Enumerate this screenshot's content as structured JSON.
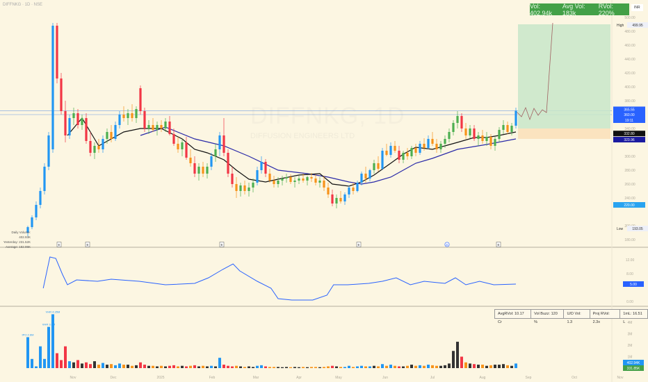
{
  "header": {
    "title": "DIFFNKG · 1D · NSE",
    "currency": "INR"
  },
  "watermark": {
    "symbol": "DIFFNKG, 1D",
    "company": "DIFFUSION ENGINEERS LTD"
  },
  "volume_box": {
    "vol": "Vol: 402.94k",
    "avg": "Avg Vol: 183k",
    "rvol": "RVol: 220%"
  },
  "daily_volume": {
    "daily": "Daily Volume: 402.93K",
    "yesterday": "Yesterday: 231.52K",
    "average": "Average: 182.99K"
  },
  "info_box": [
    "AvgRVol: 10.17 Cr",
    "Vol Buzz: 120 %",
    "U/D Vol: 1.3",
    "Proj RVol: 2.3x",
    "1mL: 16.51 L"
  ],
  "colors": {
    "up": "#4caf50",
    "down": "#f7931a",
    "strong_down": "#f23645",
    "strong_up": "#2196f3",
    "ma_short": "#111111",
    "ma_long": "#2a2aa8",
    "indicator": "#2962ff",
    "target_zone": "#c8e6c9",
    "stop_zone": "#fbe3bf"
  },
  "chart_data": [
    {
      "type": "candlestick",
      "price_axis": {
        "ticks": [
          "500.00",
          "480.00",
          "460.00",
          "440.00",
          "420.00",
          "400.00",
          "380.00",
          "340.00",
          "300.00",
          "280.00",
          "260.00",
          "240.00",
          "200.00",
          "180.00"
        ],
        "range": [
          175,
          505
        ]
      },
      "price_labels": {
        "high_label": "High",
        "high": "499.95",
        "low_label": "Low",
        "low": "193.05",
        "last": "365.55",
        "level": "360.00",
        "countdown": "19:11",
        "ma_short": "332.80",
        "ma_long": "323.96",
        "support": "220.00"
      },
      "time_axis": [
        "Nov",
        "Dec",
        "2025",
        "Feb",
        "Mar",
        "Apr",
        "May",
        "Jun",
        "Jul",
        "Aug",
        "Sep",
        "Oct",
        "Nov"
      ],
      "events": [
        "E",
        "E",
        "E",
        "E",
        "D",
        "E"
      ],
      "candles_ohlc": [
        [
          190,
          200,
          185,
          198
        ],
        [
          198,
          215,
          195,
          212
        ],
        [
          212,
          235,
          208,
          230
        ],
        [
          230,
          255,
          225,
          250
        ],
        [
          250,
          290,
          245,
          285
        ],
        [
          285,
          335,
          280,
          330
        ],
        [
          310,
          492,
          305,
          488
        ],
        [
          488,
          492,
          405,
          412
        ],
        [
          412,
          420,
          360,
          365
        ],
        [
          365,
          380,
          320,
          330
        ],
        [
          330,
          360,
          325,
          355
        ],
        [
          355,
          370,
          345,
          362
        ],
        [
          362,
          368,
          340,
          345
        ],
        [
          345,
          360,
          338,
          355
        ],
        [
          355,
          362,
          318,
          322
        ],
        [
          322,
          335,
          300,
          305
        ],
        [
          305,
          320,
          296,
          315
        ],
        [
          315,
          325,
          305,
          310
        ],
        [
          310,
          330,
          305,
          325
        ],
        [
          325,
          340,
          318,
          335
        ],
        [
          335,
          345,
          320,
          325
        ],
        [
          325,
          350,
          322,
          345
        ],
        [
          345,
          365,
          340,
          360
        ],
        [
          360,
          372,
          350,
          355
        ],
        [
          355,
          368,
          345,
          362
        ],
        [
          362,
          375,
          350,
          355
        ],
        [
          355,
          372,
          348,
          368
        ],
        [
          398,
          402,
          360,
          365
        ],
        [
          365,
          370,
          335,
          340
        ],
        [
          340,
          352,
          332,
          345
        ],
        [
          345,
          355,
          335,
          338
        ],
        [
          338,
          350,
          330,
          345
        ],
        [
          345,
          352,
          335,
          340
        ],
        [
          340,
          355,
          335,
          350
        ],
        [
          350,
          358,
          330,
          332
        ],
        [
          332,
          340,
          315,
          318
        ],
        [
          318,
          328,
          305,
          310
        ],
        [
          310,
          325,
          300,
          320
        ],
        [
          320,
          328,
          295,
          298
        ],
        [
          298,
          310,
          285,
          290
        ],
        [
          290,
          300,
          270,
          275
        ],
        [
          275,
          290,
          265,
          285
        ],
        [
          285,
          292,
          270,
          275
        ],
        [
          275,
          290,
          268,
          285
        ],
        [
          285,
          305,
          280,
          300
        ],
        [
          300,
          318,
          292,
          310
        ],
        [
          310,
          335,
          300,
          330
        ],
        [
          330,
          355,
          300,
          305
        ],
        [
          305,
          310,
          270,
          275
        ],
        [
          275,
          285,
          255,
          260
        ],
        [
          260,
          270,
          240,
          250
        ],
        [
          250,
          262,
          242,
          258
        ],
        [
          258,
          265,
          245,
          250
        ],
        [
          250,
          262,
          242,
          255
        ],
        [
          255,
          268,
          248,
          262
        ],
        [
          262,
          285,
          258,
          280
        ],
        [
          280,
          300,
          275,
          292
        ],
        [
          292,
          296,
          270,
          275
        ],
        [
          275,
          282,
          262,
          265
        ],
        [
          265,
          272,
          255,
          260
        ],
        [
          260,
          270,
          255,
          265
        ],
        [
          265,
          272,
          258,
          268
        ],
        [
          268,
          275,
          262,
          270
        ],
        [
          270,
          274,
          260,
          263
        ],
        [
          263,
          270,
          255,
          265
        ],
        [
          265,
          272,
          260,
          268
        ],
        [
          268,
          275,
          262,
          265
        ],
        [
          265,
          272,
          258,
          270
        ],
        [
          270,
          276,
          263,
          268
        ],
        [
          268,
          274,
          258,
          262
        ],
        [
          262,
          270,
          255,
          265
        ],
        [
          265,
          272,
          250,
          255
        ],
        [
          255,
          262,
          240,
          245
        ],
        [
          245,
          252,
          228,
          232
        ],
        [
          232,
          245,
          225,
          240
        ],
        [
          240,
          250,
          232,
          235
        ],
        [
          235,
          248,
          230,
          245
        ],
        [
          245,
          258,
          240,
          255
        ],
        [
          255,
          262,
          245,
          250
        ],
        [
          250,
          265,
          248,
          262
        ],
        [
          262,
          278,
          258,
          275
        ],
        [
          275,
          285,
          262,
          268
        ],
        [
          268,
          282,
          264,
          280
        ],
        [
          280,
          295,
          275,
          290
        ],
        [
          290,
          300,
          278,
          282
        ],
        [
          282,
          312,
          280,
          308
        ],
        [
          308,
          318,
          300,
          302
        ],
        [
          302,
          320,
          298,
          315
        ],
        [
          315,
          322,
          305,
          308
        ],
        [
          308,
          315,
          290,
          295
        ],
        [
          295,
          308,
          290,
          305
        ],
        [
          305,
          312,
          295,
          300
        ],
        [
          300,
          315,
          296,
          312
        ],
        [
          312,
          318,
          300,
          305
        ],
        [
          305,
          322,
          302,
          318
        ],
        [
          318,
          326,
          308,
          312
        ],
        [
          312,
          330,
          310,
          325
        ],
        [
          325,
          335,
          315,
          318
        ],
        [
          318,
          325,
          305,
          310
        ],
        [
          310,
          322,
          305,
          318
        ],
        [
          318,
          330,
          312,
          325
        ],
        [
          325,
          340,
          320,
          335
        ],
        [
          335,
          352,
          330,
          348
        ],
        [
          348,
          365,
          340,
          358
        ],
        [
          358,
          362,
          335,
          340
        ],
        [
          340,
          348,
          325,
          330
        ],
        [
          330,
          345,
          326,
          340
        ],
        [
          340,
          345,
          322,
          325
        ],
        [
          325,
          335,
          315,
          330
        ],
        [
          330,
          338,
          318,
          322
        ],
        [
          322,
          335,
          315,
          328
        ],
        [
          328,
          332,
          310,
          315
        ],
        [
          315,
          328,
          308,
          325
        ],
        [
          325,
          342,
          320,
          338
        ],
        [
          338,
          352,
          332,
          345
        ],
        [
          345,
          350,
          332,
          335
        ],
        [
          335,
          348,
          330,
          344
        ],
        [
          344,
          370,
          340,
          365.55
        ]
      ],
      "ma_short": [
        [
          9.5,
          330
        ],
        [
          13,
          355
        ],
        [
          17,
          315
        ],
        [
          20,
          325
        ],
        [
          23,
          335
        ],
        [
          27,
          340
        ],
        [
          32,
          340
        ],
        [
          37,
          325
        ],
        [
          40,
          310
        ],
        [
          43,
          305
        ],
        [
          47,
          295
        ],
        [
          50,
          280
        ],
        [
          53,
          267
        ],
        [
          57,
          263
        ],
        [
          60,
          267
        ],
        [
          65,
          273
        ],
        [
          70,
          275
        ],
        [
          73,
          260
        ],
        [
          77,
          257
        ],
        [
          80,
          263
        ],
        [
          83,
          273
        ],
        [
          87,
          290
        ],
        [
          90,
          303
        ],
        [
          93,
          313
        ],
        [
          97,
          310
        ],
        [
          100,
          315
        ],
        [
          103,
          320
        ],
        [
          107,
          327
        ],
        [
          110,
          327
        ],
        [
          113,
          330
        ],
        [
          117,
          335
        ]
      ],
      "ma_long": [
        [
          27,
          330
        ],
        [
          33,
          342
        ],
        [
          40,
          325
        ],
        [
          47,
          315
        ],
        [
          53,
          300
        ],
        [
          60,
          280
        ],
        [
          67,
          275
        ],
        [
          72,
          270
        ],
        [
          77,
          263
        ],
        [
          80,
          260
        ],
        [
          83,
          263
        ],
        [
          87,
          270
        ],
        [
          90,
          280
        ],
        [
          93,
          290
        ],
        [
          97,
          297
        ],
        [
          103,
          310
        ],
        [
          110,
          317
        ],
        [
          117,
          325
        ]
      ],
      "projection": {
        "target": 490,
        "entry": 340,
        "stop": 325
      }
    },
    {
      "type": "line",
      "axis_ticks": [
        "12.00",
        "8.00",
        "0.00"
      ],
      "last_value": "5.00",
      "range": [
        0,
        14
      ],
      "points": [
        [
          3.7,
          3.8
        ],
        [
          5.3,
          12.8
        ],
        [
          6.7,
          12.4
        ],
        [
          8.3,
          7.8
        ],
        [
          9.5,
          4.8
        ],
        [
          11.7,
          6.2
        ],
        [
          16.7,
          5.8
        ],
        [
          20,
          6.4
        ],
        [
          26.7,
          5.8
        ],
        [
          33,
          4.8
        ],
        [
          40,
          5.2
        ],
        [
          43.3,
          6.8
        ],
        [
          46.7,
          9.2
        ],
        [
          49.2,
          10.8
        ],
        [
          50.8,
          8.8
        ],
        [
          55,
          5.8
        ],
        [
          58.3,
          3.8
        ],
        [
          60,
          0.8
        ],
        [
          63.3,
          0.4
        ],
        [
          68.3,
          0.4
        ],
        [
          71.7,
          1.8
        ],
        [
          73.3,
          4.8
        ],
        [
          76.7,
          4.8
        ],
        [
          81.7,
          5.2
        ],
        [
          85,
          5.8
        ],
        [
          88.3,
          6.8
        ],
        [
          91.7,
          4.8
        ],
        [
          95,
          5.8
        ],
        [
          100,
          5.2
        ],
        [
          102.5,
          6.8
        ],
        [
          105,
          4.8
        ],
        [
          108.3,
          5.8
        ],
        [
          111.7,
          4.8
        ],
        [
          117,
          5.0
        ]
      ]
    },
    {
      "type": "bar",
      "axis_ticks": [
        "5M",
        "4M",
        "3M",
        "2M",
        "1M"
      ],
      "last_value": "402.94K",
      "average_value": "331.85K",
      "unit": "M",
      "annotations": [
        {
          "index": 0,
          "text": "IPO 2.6M"
        },
        {
          "index": 5,
          "text": "VHR 3.6M"
        },
        {
          "index": 6,
          "text": "VHR 4.35M"
        }
      ],
      "values": [
        2.7,
        0.8,
        0.15,
        1.9,
        0.8,
        3.6,
        4.7,
        1.3,
        0.7,
        1.9,
        0.6,
        0.5,
        0.7,
        0.4,
        0.5,
        0.35,
        0.6,
        0.3,
        0.45,
        0.3,
        0.35,
        0.25,
        0.4,
        0.3,
        0.3,
        0.2,
        0.25,
        0.5,
        0.3,
        0.2,
        0.2,
        0.15,
        0.2,
        0.15,
        0.2,
        0.25,
        0.15,
        0.2,
        0.15,
        0.2,
        0.25,
        0.15,
        0.2,
        0.15,
        0.2,
        0.15,
        0.9,
        0.3,
        0.2,
        0.15,
        0.2,
        0.15,
        0.1,
        0.15,
        0.1,
        0.2,
        0.25,
        0.15,
        0.1,
        0.1,
        0.1,
        0.08,
        0.1,
        0.08,
        0.1,
        0.08,
        0.1,
        0.08,
        0.1,
        0.1,
        0.08,
        0.1,
        0.15,
        0.2,
        0.15,
        0.1,
        0.1,
        0.2,
        0.1,
        0.15,
        0.2,
        0.15,
        0.15,
        0.2,
        0.15,
        0.35,
        0.2,
        0.3,
        0.2,
        0.15,
        0.15,
        0.2,
        0.3,
        0.2,
        0.25,
        0.2,
        0.3,
        0.25,
        0.2,
        0.2,
        0.25,
        0.4,
        1.5,
        2.3,
        1.0,
        0.5,
        0.4,
        0.35,
        0.3,
        0.3,
        0.2,
        0.25,
        0.3,
        0.3,
        0.35,
        0.25,
        0.2,
        0.4
      ]
    }
  ]
}
